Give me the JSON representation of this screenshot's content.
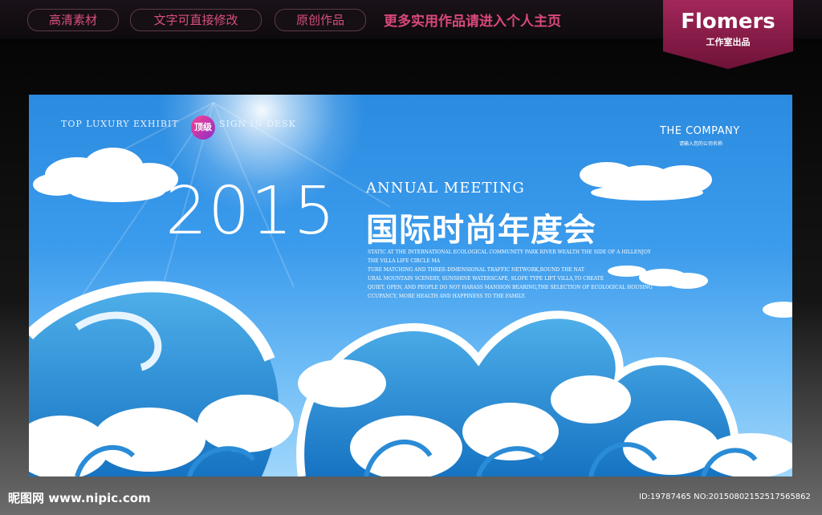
{
  "top_banner": {
    "tags": [
      "高清素材",
      "文字可直接修改",
      "原创作品"
    ],
    "more_text": "更多实用作品请进入个人主页",
    "brand_name": "Flomers",
    "brand_sub": "工作室出品"
  },
  "poster": {
    "tagline_left": "TOP LUXURY EXHIBIT",
    "badge": "顶级",
    "tagline_right": "SIGN IN DESK",
    "company_name": "THE COMPANY",
    "company_sub": "请输入您的公司名称",
    "year": "2015",
    "annual": "ANNUAL MEETING",
    "cn_title": "国际时尚年度会",
    "body_lines": [
      "STATIC AT THE INTERNATIONAL ECOLOGICAL COMMUNITY PARK RIVER WEALTH THE SIDE OF A HILLENJOY",
      "THE VILLA LIFE CIRCLE MA",
      "TURE MATCHING AND THREE-DIMENSIONAL TRAFFIC NETWORK,ROUND THE NAT",
      "URAL MOUNTAIN SCENERY, SUNSHINE WATERSCAPE, SLOPE TYPE LIFT VILLA,TO CREATE",
      "QUIET, OPEN, AND PEOPLE DO NOT HARASS MANSION BEARING,THE SELECTION OF ECOLOGICAL HOUSING",
      "CCUPANCY, MORE HEALTH AND HAPPINESS TO THE FAMILY."
    ]
  },
  "watermark": {
    "site": "昵图网 www.nipic.com",
    "id": "ID:19787465 NO:20150802152517565862"
  },
  "colors": {
    "tag_text": "#d84f7e",
    "brand_bg": "#8e1d4c",
    "sky_top": "#2b8be0",
    "wave_dark": "#1f86d2",
    "wave_light": "#ffffff"
  }
}
